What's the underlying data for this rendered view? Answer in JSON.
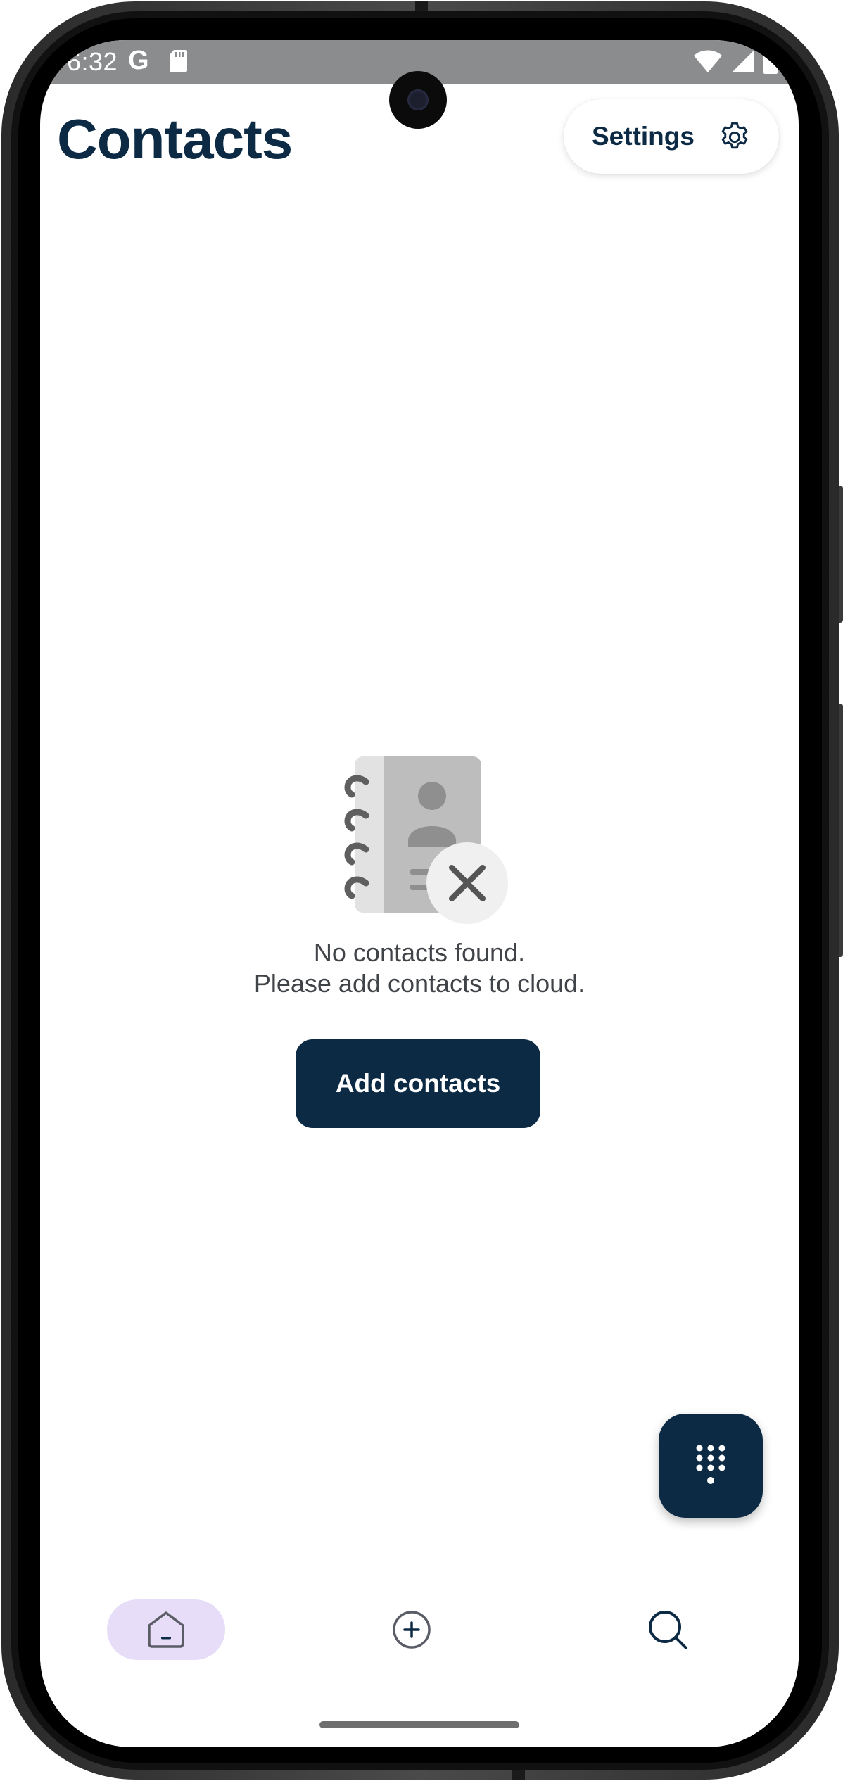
{
  "status_bar": {
    "time": "6:32",
    "g_glyph": "G",
    "icons": [
      "g-icon",
      "sd-card-icon",
      "wifi-icon",
      "signal-icon",
      "battery-icon"
    ]
  },
  "header": {
    "title": "Contacts",
    "settings_label": "Settings",
    "settings_icon": "gear-icon"
  },
  "empty_state": {
    "illustration": "contact-book-with-x-icon",
    "line1": "No contacts found.",
    "line2": "Please add contacts to cloud.",
    "button_label": "Add contacts"
  },
  "fab": {
    "icon": "dialpad-icon"
  },
  "bottom_nav": {
    "items": [
      {
        "icon": "home-icon",
        "selected": true
      },
      {
        "icon": "add-circle-icon",
        "selected": false
      },
      {
        "icon": "search-icon",
        "selected": false
      }
    ]
  },
  "colors": {
    "primary": "#0d2a45",
    "nav_selected_bg": "#e8ddf8",
    "status_bar_bg": "#8b8c8e",
    "body_text": "#404348"
  }
}
